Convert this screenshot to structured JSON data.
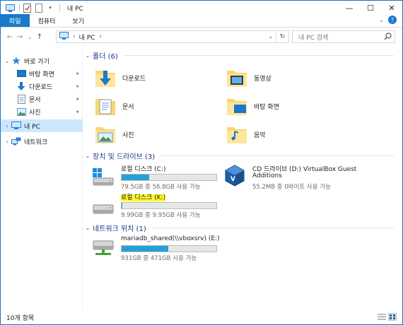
{
  "window": {
    "title": "내 PC",
    "controls": {
      "minimize": "—",
      "maximize": "☐",
      "close": "✕"
    }
  },
  "ribbon": {
    "tabs": [
      {
        "label": "파일",
        "active": true
      },
      {
        "label": "컴퓨터",
        "active": false
      },
      {
        "label": "보기",
        "active": false
      }
    ]
  },
  "address": {
    "back": "←",
    "forward": "→",
    "recent": "⌄",
    "up": "↑",
    "crumb": "내 PC",
    "chevron": "›",
    "dropdown": "⌄",
    "refresh": "↻"
  },
  "search": {
    "placeholder": "내 PC 검색",
    "icon": "search-icon"
  },
  "nav_pane": {
    "quick_access": {
      "label": "바로 가기",
      "toggle": "⌄"
    },
    "quick_items": [
      {
        "label": "바탕 화면",
        "icon": "desktop-icon"
      },
      {
        "label": "다운로드",
        "icon": "download-icon"
      },
      {
        "label": "문서",
        "icon": "document-icon"
      },
      {
        "label": "사진",
        "icon": "pictures-icon"
      }
    ],
    "this_pc": {
      "label": "내 PC",
      "toggle": "›"
    },
    "network": {
      "label": "네트워크",
      "toggle": "›"
    }
  },
  "groups": {
    "folders": {
      "title": "폴더 (6)",
      "toggle": "⌄"
    },
    "drives": {
      "title": "장치 및 드라이브 (3)",
      "toggle": "⌄"
    },
    "network_locations": {
      "title": "네트워크 위치 (1)",
      "toggle": "⌄"
    }
  },
  "folders": [
    {
      "label": "다운로드",
      "icon": "downloads-folder-icon"
    },
    {
      "label": "동영상",
      "icon": "videos-folder-icon"
    },
    {
      "label": "문서",
      "icon": "documents-folder-icon"
    },
    {
      "label": "바탕 화면",
      "icon": "desktop-folder-icon"
    },
    {
      "label": "사진",
      "icon": "pictures-folder-icon"
    },
    {
      "label": "음악",
      "icon": "music-folder-icon"
    }
  ],
  "drives": [
    {
      "name": "로컬 디스크 (C:)",
      "free": "79.5GB 중 56.8GB 사용 가능",
      "used_fraction": 0.29,
      "icon": "windows-drive-icon",
      "highlighted": false
    },
    {
      "name": "CD 드라이브 (D:) VirtualBox Guest Additions",
      "name_line1": "CD 드라이브 (D:) VirtualBox Guest",
      "name_line2": "Additions",
      "free": "55.2MB 중 0바이트 사용 가능",
      "icon": "virtualbox-cd-icon"
    },
    {
      "name": "로컬 디스크 (K:)",
      "free": "9.99GB 중 9.95GB 사용 가능",
      "used_fraction": 0.004,
      "icon": "hard-drive-icon",
      "highlighted": true
    }
  ],
  "network_locations": [
    {
      "name": "mariadb_shared(\\\\vboxsrv) (E:)",
      "free": "931GB 중 471GB 사용 가능",
      "used_fraction": 0.49,
      "icon": "network-drive-icon"
    }
  ],
  "status": {
    "count": "10개 항목"
  },
  "colors": {
    "accent": "#1979ca",
    "bar_fill": "#26a0da",
    "group_title": "#1e3287",
    "selection": "#cce8ff",
    "highlight": "#fffb2a"
  }
}
